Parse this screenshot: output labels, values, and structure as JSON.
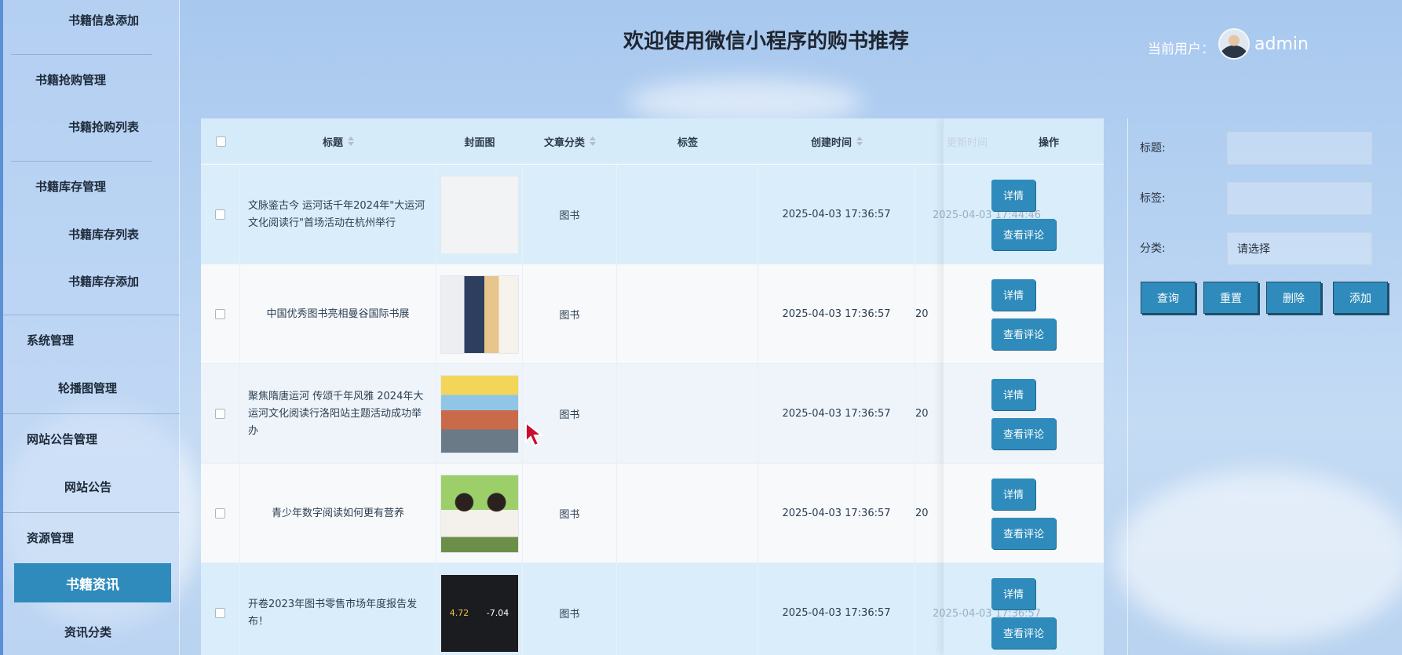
{
  "sidebar": {
    "items": [
      {
        "label": "书籍信息添加"
      },
      {
        "label": "书籍抢购管理"
      },
      {
        "label": "书籍抢购列表"
      },
      {
        "label": "书籍库存管理"
      },
      {
        "label": "书籍库存列表"
      },
      {
        "label": "书籍库存添加"
      },
      {
        "label": "系统管理"
      },
      {
        "label": "轮播图管理"
      },
      {
        "label": "网站公告管理"
      },
      {
        "label": "网站公告"
      },
      {
        "label": "资源管理"
      },
      {
        "label": "书籍资讯"
      },
      {
        "label": "资讯分类"
      }
    ]
  },
  "header": {
    "title": "欢迎使用微信小程序的购书推荐",
    "user_label": "当前用户：",
    "user_name": "admin"
  },
  "table": {
    "columns": [
      "标题",
      "封面图",
      "文章分类",
      "标签",
      "创建时间",
      "更新时间",
      "操作"
    ],
    "rows": [
      {
        "title": "文脉鉴古今 运河话千年2024年\"大运河文化阅读行\"首场活动在杭州举行",
        "category": "图书",
        "tag": "",
        "created": "2025-04-03 17:36:57",
        "updated": "2025-04-03 17:44:46"
      },
      {
        "title": "中国优秀图书亮相曼谷国际书展",
        "category": "图书",
        "tag": "",
        "created": "2025-04-03 17:36:57",
        "updated": "20"
      },
      {
        "title": "聚焦隋唐运河 传颂千年风雅 2024年大运河文化阅读行洛阳站主题活动成功举办",
        "category": "图书",
        "tag": "",
        "created": "2025-04-03 17:36:57",
        "updated": "20"
      },
      {
        "title": "青少年数字阅读如何更有营养",
        "category": "图书",
        "tag": "",
        "created": "2025-04-03 17:36:57",
        "updated": "20"
      },
      {
        "title": "开卷2023年图书零售市场年度报告发布！",
        "category": "图书",
        "tag": "",
        "created": "2025-04-03 17:36:57",
        "updated": "2025-04-03 17:36:57"
      }
    ],
    "detail_label": "详情",
    "comment_label": "查看评论",
    "cover5_values": [
      "4.72",
      "-7.04"
    ]
  },
  "filters": {
    "title_label": "标题:",
    "tag_label": "标签:",
    "category_label": "分类:",
    "category_placeholder": "请选择",
    "buttons": [
      "查询",
      "重置",
      "删除",
      "添加"
    ]
  },
  "colors": {
    "accent": "#2f8bbb",
    "header_row": "#d6ebfa"
  }
}
